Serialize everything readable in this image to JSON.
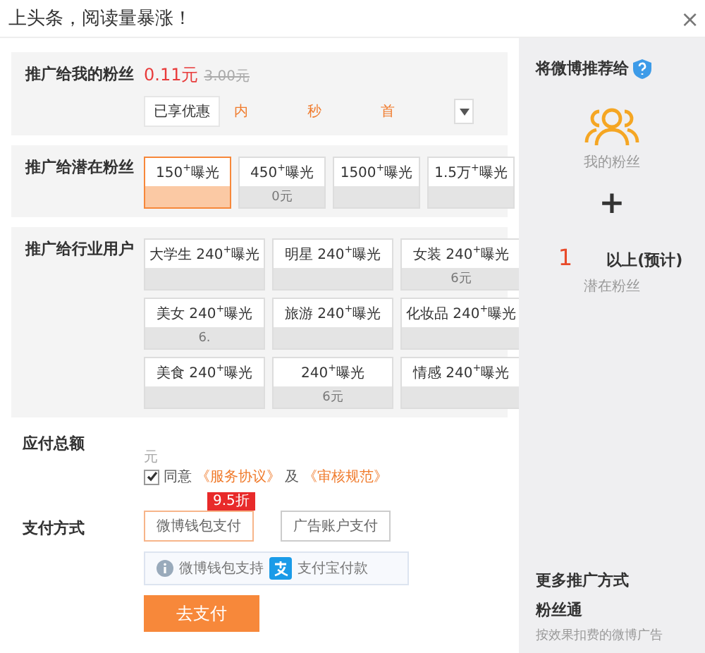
{
  "header": {
    "title": "上头条，阅读量暴涨！",
    "close": "×"
  },
  "my_fans": {
    "label": "推广给我的粉丝",
    "price": "0.11元",
    "old_price": "3.00元",
    "discount_tag": "已享优惠",
    "promos": [
      "内",
      "秒",
      "首"
    ]
  },
  "potential_fans": {
    "label": "推广给潜在粉丝",
    "options": [
      {
        "title": "150$^{+}$曝光",
        "selected": true
      },
      {
        "title": "450$^{+}$曝光",
        "price": "0元",
        "selected": false
      },
      {
        "title": "1500$^{+}$曝光",
        "selected": false
      },
      {
        "title": "1.5万$^{+}$曝光",
        "selected": false
      }
    ]
  },
  "industry": {
    "label": "推广给行业用户",
    "options": [
      {
        "title": "大学生 240$^{+}$曝光",
        "selected": false
      },
      {
        "title": "明星 240$^{+}$曝光",
        "selected": false
      },
      {
        "title": "女装 240$^{+}$曝光",
        "price": "6元",
        "selected": false
      },
      {
        "title": "美女 240$^{+}$曝光",
        "price": "6.",
        "selected": false
      },
      {
        "title": "旅游 240$^{+}$曝光",
        "selected": false
      },
      {
        "title": "化妆品 240$^{+}$曝光",
        "selected": false
      },
      {
        "title": "美食 240$^{+}$曝光",
        "selected": false
      },
      {
        "title": "240$^{+}$曝光",
        "price": "6元",
        "selected": false
      },
      {
        "title": "情感 240$^{+}$曝光",
        "selected": false
      }
    ]
  },
  "total": {
    "label": "应付总额",
    "unit": "元"
  },
  "agreement": {
    "checked": true,
    "prefix": "同意",
    "link1": "《服务协议》",
    "conj": "及",
    "link2": "《审核规范》"
  },
  "payment": {
    "label": "支付方式",
    "discount_badge": "9.5折",
    "methods": [
      {
        "label": "微博钱包支付",
        "selected": true
      },
      {
        "label": "广告账户支付",
        "selected": false
      }
    ],
    "info": "微博钱包支持",
    "alipay": "支付宝付款",
    "pay_button": "去支付"
  },
  "sidebar": {
    "title": "将微博推荐给",
    "my_fans": "我的粉丝",
    "plus": "+",
    "count": "1",
    "count_suffix": "以上(预计)",
    "potential": "潜在粉丝",
    "more_title": "更多推广方式",
    "more_item": "粉丝通",
    "more_desc": "按效果扣费的微博广告"
  }
}
